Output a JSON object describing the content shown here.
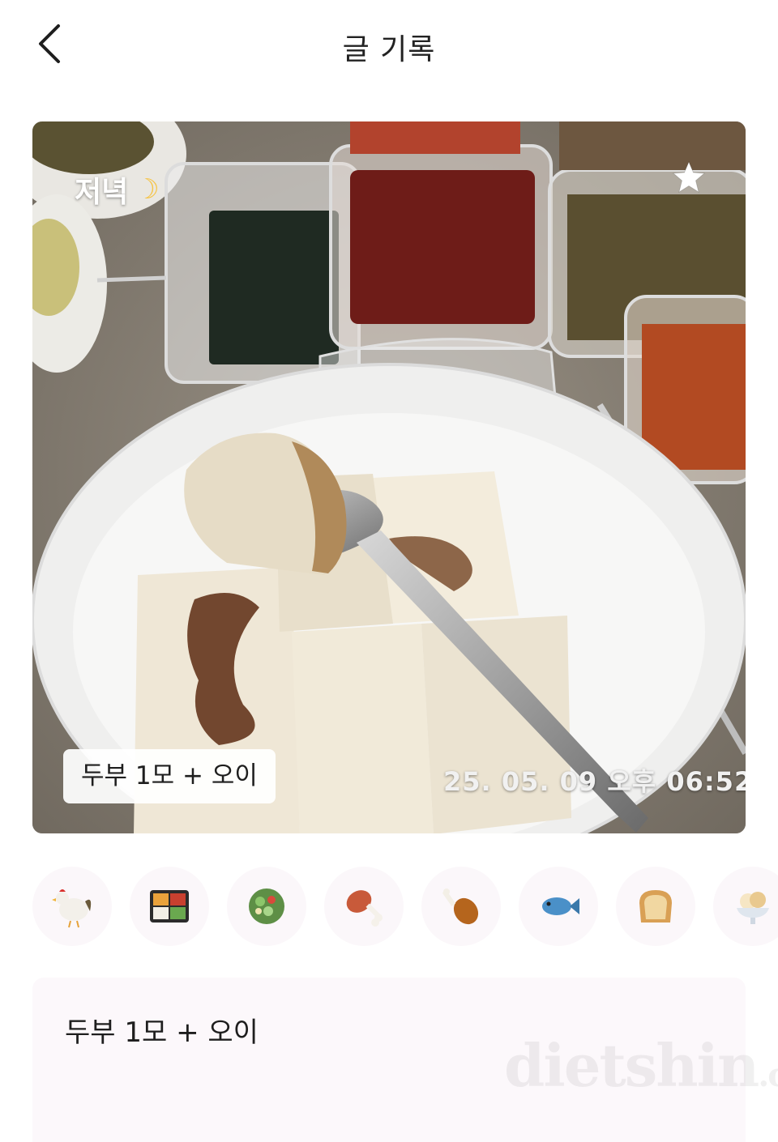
{
  "header": {
    "title": "글 기록",
    "back_icon": "chevron-left-icon"
  },
  "photo": {
    "meal_label": "저녁",
    "meal_icon": "crescent-moon-icon",
    "favorite_icon": "star-icon",
    "caption": "두부 1모 + 오이",
    "timestamp": "25. 05. 09  오후 06:52"
  },
  "food_icons": [
    {
      "name": "rooster",
      "glyph": "🐓"
    },
    {
      "name": "bento-box",
      "glyph": "🍱"
    },
    {
      "name": "salad",
      "glyph": "🥗"
    },
    {
      "name": "meat-on-bone",
      "glyph": "🍖"
    },
    {
      "name": "poultry-leg",
      "glyph": "🍗"
    },
    {
      "name": "fish",
      "glyph": "🐟"
    },
    {
      "name": "bread",
      "glyph": "🍞"
    },
    {
      "name": "ice-cream",
      "glyph": "🍨"
    }
  ],
  "note": {
    "text": "두부 1모 + 오이",
    "watermark": "dietshin",
    "watermark_suffix": ".com"
  },
  "colors": {
    "moon": "#f6c343",
    "note_background": "#fcf8fb",
    "icon_background": "#fbf7fa"
  }
}
